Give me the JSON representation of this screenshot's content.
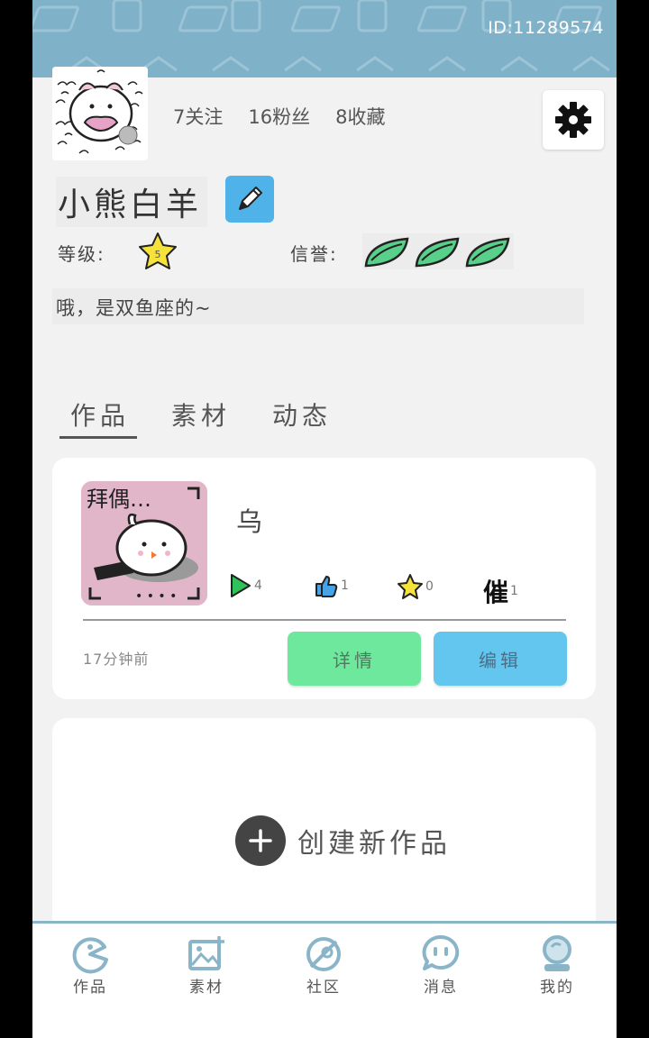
{
  "header": {
    "user_id": "ID:11289574",
    "stats": {
      "following": "7关注",
      "followers": "16粉丝",
      "favorites": "8收藏"
    },
    "username": "小熊白羊",
    "level_label": "等级:",
    "level_value": "5",
    "credit_label": "信誉:",
    "credit_leaves": 3,
    "bio": "哦，是双鱼座的~"
  },
  "tabs": [
    {
      "label": "作品",
      "active": true
    },
    {
      "label": "素材",
      "active": false
    },
    {
      "label": "动态",
      "active": false
    }
  ],
  "work_card": {
    "thumb_caption": "拜偶…",
    "title": "乌",
    "plays": "4",
    "likes": "1",
    "stars": "0",
    "urges": "1",
    "urge_label": "催",
    "time": "17分钟前",
    "detail_label": "详情",
    "edit_label": "编辑"
  },
  "create": {
    "label": "创建新作品"
  },
  "bottom_nav": [
    {
      "label": "作品",
      "icon": "works-icon"
    },
    {
      "label": "素材",
      "icon": "material-icon"
    },
    {
      "label": "社区",
      "icon": "community-icon"
    },
    {
      "label": "消息",
      "icon": "message-icon"
    },
    {
      "label": "我的",
      "icon": "profile-icon"
    }
  ],
  "colors": {
    "banner": "#7fb2c8",
    "edit_button": "#4fb3ea",
    "detail_button": "#6ee89c",
    "edit_work_button": "#62c6ee",
    "nav_icon": "#8ab5c9"
  }
}
